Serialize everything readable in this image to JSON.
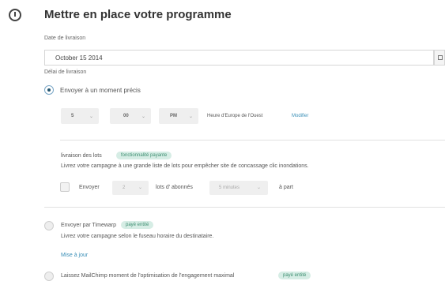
{
  "title": "Mettre en place votre programme",
  "delivery_date_label": "Date de livraison",
  "delivery_date_value": "October 15 2014",
  "delay_label": "Délai de livraison",
  "option_specific": "Envoyer à un moment précis",
  "time": {
    "hour": "5",
    "minute": "00",
    "ampm": "PM"
  },
  "timezone_text": "Heure d'Europe de l'Ouest",
  "modify_link": "Modifier",
  "batch": {
    "title": "livraison des lots",
    "badge": "fonctionnalité payante",
    "description": "Livrez votre campagne à une grande liste de lots pour empêcher site de concassage clic inondations.",
    "send_label": "Envoyer",
    "count": "2",
    "subscribers_label": "lots d' abonnés",
    "interval": "5 minutes",
    "apart_label": "à part"
  },
  "timewarp": {
    "label": "Envoyer par Timewarp",
    "badge": "payé entité",
    "description": "Livrez votre campagne selon le fuseau horaire du destinataire.",
    "update_link": "Mise à jour"
  },
  "optimization": {
    "label": "Laissez MailChimp moment de l'optimisation de l'engagement maximal",
    "badge": "payé entité"
  }
}
